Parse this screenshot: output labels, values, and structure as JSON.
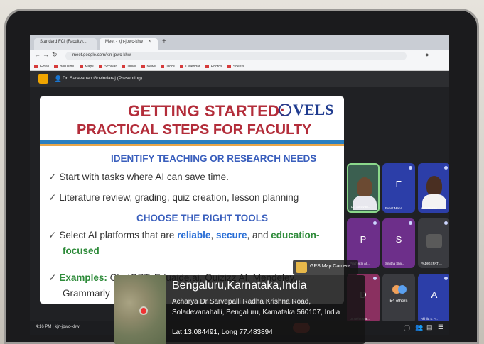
{
  "browser": {
    "tabs": [
      {
        "label": "Standard FCI (Faculty)..."
      },
      {
        "label": "Meet - kjn-jpwc-khw"
      }
    ],
    "url": "meet.google.com/kjn-jpwc-khw",
    "bookmarks": [
      "Gmail",
      "YouTube",
      "Maps",
      "Scholar",
      "Drive",
      "News",
      "Docs",
      "Calendar",
      "Photos",
      "Sheets"
    ]
  },
  "meet": {
    "presenter_label": "Dr. Saravanan Govindaraj (Presenting)",
    "meeting_code": "kjn-jpwc-khw",
    "time": "4:16 PM",
    "participants": [
      {
        "name": "Dr. Saravan...",
        "initial": "",
        "tile": "video",
        "active": true
      },
      {
        "name": "Event Mana...",
        "initial": "E",
        "tile": "letter"
      },
      {
        "name": "Kumaresan...",
        "initial": "",
        "tile": "video"
      },
      {
        "name": "Prathviraj Al...",
        "initial": "P",
        "tile": "letter"
      },
      {
        "name": "Smitha Shiv...",
        "initial": "S",
        "tile": "letter"
      },
      {
        "name": "PADIGEPATI...",
        "initial": "",
        "tile": "gray"
      },
      {
        "name": "Dr.Neha Ma...",
        "initial": "D",
        "tile": "letter"
      },
      {
        "name": "54 others",
        "initial": "",
        "tile": "others"
      },
      {
        "name": "Akhila K P...",
        "initial": "A",
        "tile": "letter"
      }
    ]
  },
  "slide": {
    "title_line1": "GETTING STARTED:",
    "title_line2": "PRACTICAL STEPS FOR FACULTY",
    "logo": "VELS",
    "heading1": "IDENTIFY TEACHING OR RESEARCH NEEDS",
    "bullet1": "Start with tasks where AI can save time.",
    "bullet2": "Literature review, grading, quiz creation, lesson planning",
    "heading2": "CHOOSE THE RIGHT TOOLS",
    "bullet3_pre": "Select AI platforms that are ",
    "bullet3_reliable": "reliable",
    "bullet3_comma": ", ",
    "bullet3_secure": "secure",
    "bullet3_and": ", and ",
    "bullet3_edu": "education-",
    "bullet3_focused": "focused",
    "bullet4_label": "Examples:",
    "bullet4_rest": "ChatGPT, Eduaide.ai, Quizizz AI, Mendeley,",
    "bullet4_cont": "Grammarly"
  },
  "gps": {
    "badge": "GPS Map Camera",
    "city": "Bengaluru,Karnataka,India",
    "address": "Acharya Dr Sarvepalli Radha Krishna Road, Soladevanahalli, Bengaluru, Karnataka 560107, India",
    "coords": "Lat 13.084491, Long 77.483894"
  }
}
